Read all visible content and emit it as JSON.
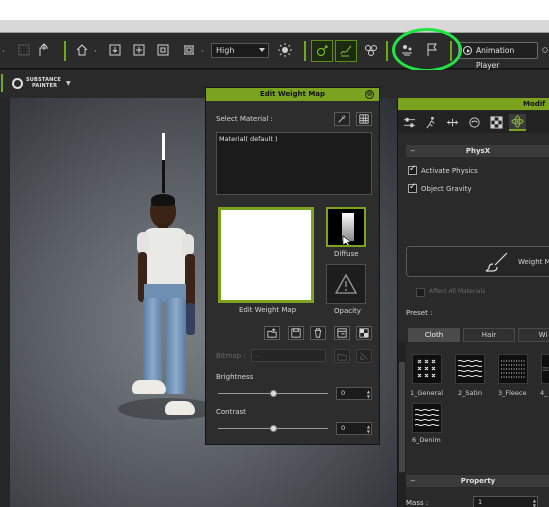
{
  "toolbar": {
    "quality_select": "High",
    "animation_player_label": "Animation Player"
  },
  "substance": {
    "line1": "SUBSTANCE",
    "line2": "PAINTER"
  },
  "weight_map": {
    "title": "Edit Weight Map",
    "select_material_label": "Select Material :",
    "material_item": "Material( default )",
    "edit_weight_map_label": "Edit Weight Map",
    "diffuse_label": "Diffuse",
    "opacity_label": "Opacity",
    "bitmap_label": "Bitmap :",
    "bitmap_value": "...",
    "brightness_label": "Brightness",
    "brightness_value": "0",
    "brightness_level": 0.5,
    "contrast_label": "Contrast",
    "contrast_value": "0",
    "contrast_level": 0.5
  },
  "modify": {
    "title": "Modif",
    "physx_header": "PhysX",
    "activate_physics_label": "Activate Physics",
    "activate_physics_checked": true,
    "object_gravity_label": "Object Gravity",
    "object_gravity_checked": true,
    "weight_map_button_label": "Weight M",
    "affect_all_materials_label": "Affect All Materials",
    "preset_label": "Preset :",
    "cloth_tabs": [
      "Cloth",
      "Hair",
      "Wi"
    ],
    "presets": [
      {
        "label": "1_General",
        "icon": "grid-x-icon"
      },
      {
        "label": "2_Satin",
        "icon": "wave-icon"
      },
      {
        "label": "3_Fleece",
        "icon": "fleece-icon"
      },
      {
        "label": "4_",
        "icon": "lines-icon"
      },
      {
        "label": "6_Denim",
        "icon": "wave-icon"
      }
    ],
    "property_header": "Property",
    "mass_label": "Mass :",
    "mass_value": "1"
  },
  "colors": {
    "accent_green": "#7ba320",
    "highlight_ring": "#22e444"
  }
}
